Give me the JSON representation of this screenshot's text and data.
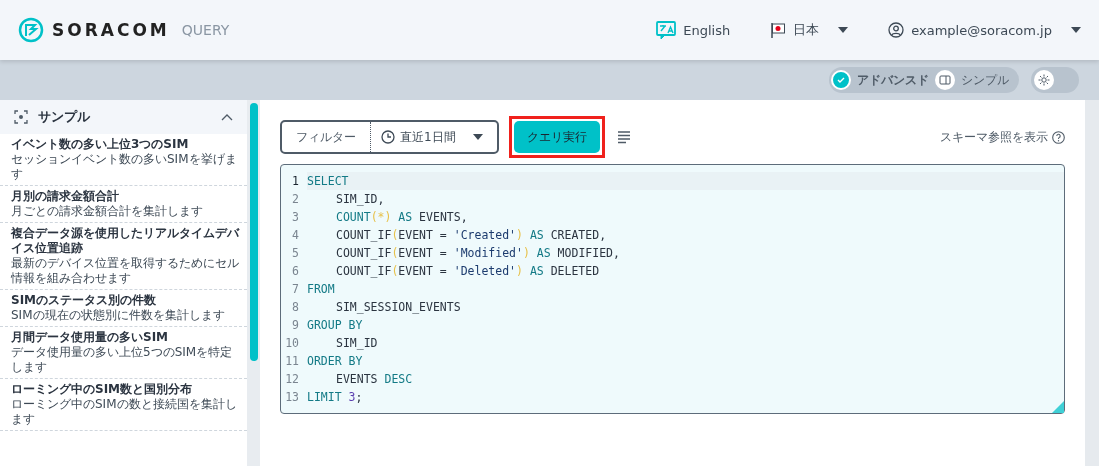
{
  "header": {
    "brand": "SORACOM",
    "product": "QUERY",
    "language": "English",
    "region": "日本",
    "account": "example@soracom.jp"
  },
  "theme_toggle": {
    "dark": false
  },
  "mode_toggle": [
    {
      "label": "アドバンスド",
      "selected": true
    },
    {
      "label": "シンプル",
      "selected": false
    }
  ],
  "sidebar": {
    "title": "サンプル",
    "expanded": true,
    "items": [
      {
        "title": "イベント数の多い上位3つのSIM",
        "description": "セッションイベント数の多いSIMを挙げます"
      },
      {
        "title": "月別の請求金額合計",
        "description": "月ごとの請求金額合計を集計します"
      },
      {
        "title": "複合データ源を使用したリアルタイムデバイス位置追跡",
        "description": "最新のデバイス位置を取得するためにセル情報を組み合わせます"
      },
      {
        "title": "SIMのステータス別の件数",
        "description": "SIMの現在の状態別に件数を集計します"
      },
      {
        "title": "月間データ使用量の多いSIM",
        "description": "データ使用量の多い上位5つのSIMを特定します"
      },
      {
        "title": "ローミング中のSIM数と国別分布",
        "description": "ローミング中のSIMの数と接続国を集計します"
      }
    ]
  },
  "toolbar": {
    "filter_label": "フィルター",
    "time_range": "直近1日間",
    "run_button": {
      "label": "クエリ実行",
      "highlighted": true
    },
    "schema_link": "スキーマ参照を表示"
  },
  "editor": {
    "lines": [
      {
        "number": "1",
        "active": true,
        "indented": false,
        "tokens": [
          {
            "kind": "kw",
            "text": "SELECT"
          }
        ]
      },
      {
        "number": "2",
        "active": false,
        "indented": true,
        "tokens": [
          {
            "kind": "id",
            "text": "SIM_ID,"
          }
        ]
      },
      {
        "number": "3",
        "active": false,
        "indented": true,
        "tokens": [
          {
            "kind": "kw",
            "text": "COUNT"
          },
          {
            "kind": "paren",
            "text": "(*)"
          },
          {
            "kind": "kw",
            "text": " AS"
          },
          {
            "kind": "id",
            "text": " EVENTS,"
          }
        ]
      },
      {
        "number": "4",
        "active": false,
        "indented": true,
        "tokens": [
          {
            "kind": "id",
            "text": "COUNT_IF"
          },
          {
            "kind": "paren",
            "text": "("
          },
          {
            "kind": "id",
            "text": "EVENT = "
          },
          {
            "kind": "str",
            "text": "'Created'"
          },
          {
            "kind": "paren",
            "text": ")"
          },
          {
            "kind": "kw",
            "text": " AS"
          },
          {
            "kind": "id",
            "text": " CREATED,"
          }
        ]
      },
      {
        "number": "5",
        "active": false,
        "indented": true,
        "tokens": [
          {
            "kind": "id",
            "text": "COUNT_IF"
          },
          {
            "kind": "paren",
            "text": "("
          },
          {
            "kind": "id",
            "text": "EVENT = "
          },
          {
            "kind": "str",
            "text": "'Modified'"
          },
          {
            "kind": "paren",
            "text": ")"
          },
          {
            "kind": "kw",
            "text": " AS"
          },
          {
            "kind": "id",
            "text": " MODIFIED,"
          }
        ]
      },
      {
        "number": "6",
        "active": false,
        "indented": true,
        "tokens": [
          {
            "kind": "id",
            "text": "COUNT_IF"
          },
          {
            "kind": "paren",
            "text": "("
          },
          {
            "kind": "id",
            "text": "EVENT = "
          },
          {
            "kind": "str",
            "text": "'Deleted'"
          },
          {
            "kind": "paren",
            "text": ")"
          },
          {
            "kind": "kw",
            "text": " AS"
          },
          {
            "kind": "id",
            "text": " DELETED"
          }
        ]
      },
      {
        "number": "7",
        "active": false,
        "indented": false,
        "tokens": [
          {
            "kind": "kw",
            "text": "FROM"
          }
        ]
      },
      {
        "number": "8",
        "active": false,
        "indented": true,
        "tokens": [
          {
            "kind": "id",
            "text": "SIM_SESSION_EVENTS"
          }
        ]
      },
      {
        "number": "9",
        "active": false,
        "indented": false,
        "tokens": [
          {
            "kind": "kw",
            "text": "GROUP BY"
          }
        ]
      },
      {
        "number": "10",
        "active": false,
        "indented": true,
        "tokens": [
          {
            "kind": "id",
            "text": "SIM_ID"
          }
        ]
      },
      {
        "number": "11",
        "active": false,
        "indented": false,
        "tokens": [
          {
            "kind": "kw",
            "text": "ORDER BY"
          }
        ]
      },
      {
        "number": "12",
        "active": false,
        "indented": true,
        "tokens": [
          {
            "kind": "id",
            "text": "EVENTS "
          },
          {
            "kind": "kw",
            "text": "DESC"
          }
        ]
      },
      {
        "number": "13",
        "active": false,
        "indented": false,
        "tokens": [
          {
            "kind": "kw",
            "text": "LIMIT "
          },
          {
            "kind": "num",
            "text": "3"
          },
          {
            "kind": "id",
            "text": ";"
          }
        ]
      }
    ]
  }
}
